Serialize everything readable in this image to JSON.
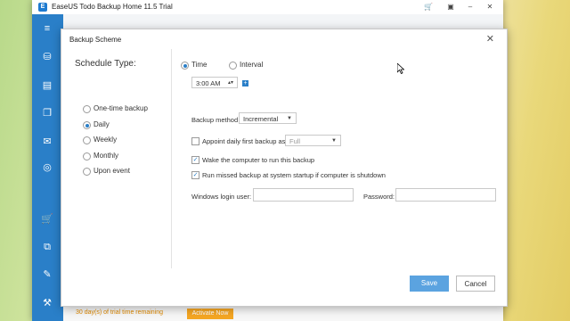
{
  "app": {
    "title": "EaseUS Todo Backup Home 11.5 Trial",
    "trial_text": "30 day(s) of trial time remaining",
    "activate_label": "Activate Now"
  },
  "dialog": {
    "title": "Backup Scheme",
    "close_glyph": "✕",
    "schedule_type_label": "Schedule Type:",
    "schedule_options": [
      {
        "label": "One-time backup",
        "selected": false
      },
      {
        "label": "Daily",
        "selected": true
      },
      {
        "label": "Weekly",
        "selected": false
      },
      {
        "label": "Monthly",
        "selected": false
      },
      {
        "label": "Upon event",
        "selected": false
      }
    ],
    "time_label": "Time",
    "interval_label": "Interval",
    "time_value": "3:00 AM",
    "backup_method_label": "Backup method",
    "backup_method_value": "Incremental",
    "appoint_label": "Appoint daily first backup as",
    "appoint_value": "Full",
    "wake_label": "Wake the computer to run this backup",
    "missed_label": "Run missed backup at system startup if computer is shutdown",
    "login_user_label": "Windows login user:",
    "password_label": "Password:",
    "login_user_value": "",
    "password_value": "",
    "save_label": "Save",
    "cancel_label": "Cancel"
  },
  "accent_color": "#2a7fc8"
}
